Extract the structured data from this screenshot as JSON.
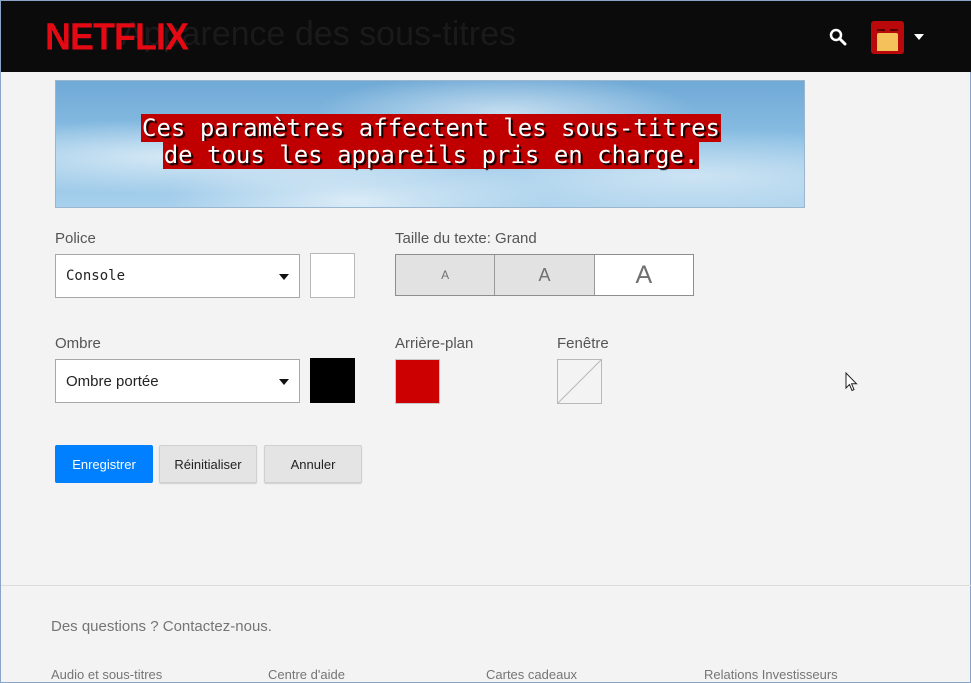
{
  "header": {
    "logo": "NETFLIX",
    "page_title": "Apparence des sous-titres",
    "icons": [
      "search-icon",
      "avatar",
      "caret-down-icon"
    ]
  },
  "preview": {
    "line1": "Ces paramètres affectent les sous-titres",
    "line2": "de tous les appareils pris en charge."
  },
  "font": {
    "label": "Police",
    "value": "Console",
    "color": "#ffffff"
  },
  "text_size": {
    "label": "Taille du texte: Grand",
    "options": [
      "A",
      "A",
      "A"
    ],
    "selected_index": 2
  },
  "shadow": {
    "label": "Ombre",
    "value": "Ombre portée",
    "color": "#000000"
  },
  "background": {
    "label": "Arrière-plan",
    "color": "#cc0000"
  },
  "window": {
    "label": "Fenêtre",
    "color": "none"
  },
  "actions": {
    "save": "Enregistrer",
    "reset": "Réinitialiser",
    "cancel": "Annuler"
  },
  "footer": {
    "contact": "Des questions ? Contactez-nous.",
    "links": [
      "Audio et sous-titres",
      "Centre d'aide",
      "Cartes cadeaux",
      "Relations Investisseurs"
    ]
  },
  "colors": {
    "brand": "#e50914",
    "primary_button": "#0080ff"
  }
}
